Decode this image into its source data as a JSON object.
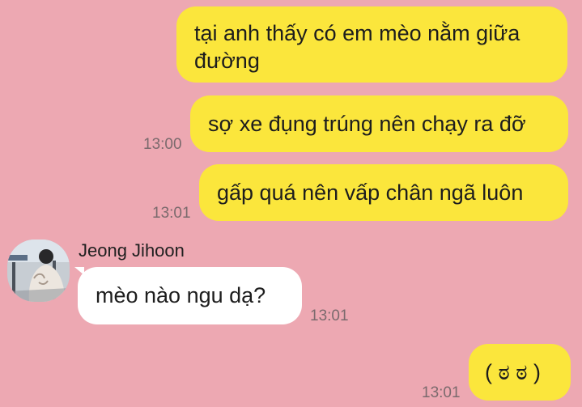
{
  "chat": {
    "messages": [
      {
        "direction": "out",
        "text_line_1": "tại anh thấy có em mèo nằm giữa",
        "text_line_2": "đường"
      },
      {
        "direction": "out",
        "text": "sợ xe đụng trúng nên chạy ra đỡ",
        "time": "13:00"
      },
      {
        "direction": "out",
        "text": "gấp quá nên vấp chân ngã luôn",
        "time": "13:01"
      },
      {
        "direction": "in",
        "sender": "Jeong Jihoon",
        "text": "mèo nào ngu dạ?",
        "time": "13:01"
      },
      {
        "direction": "out",
        "text": "( ಠ ಠ )",
        "time": "13:01"
      }
    ]
  },
  "colors": {
    "background": "#eda8b2",
    "outgoing_bubble": "#fbe63c",
    "incoming_bubble": "#ffffff",
    "timestamp": "#7b6a6d"
  },
  "icons": {
    "avatar": "contact-photo"
  }
}
